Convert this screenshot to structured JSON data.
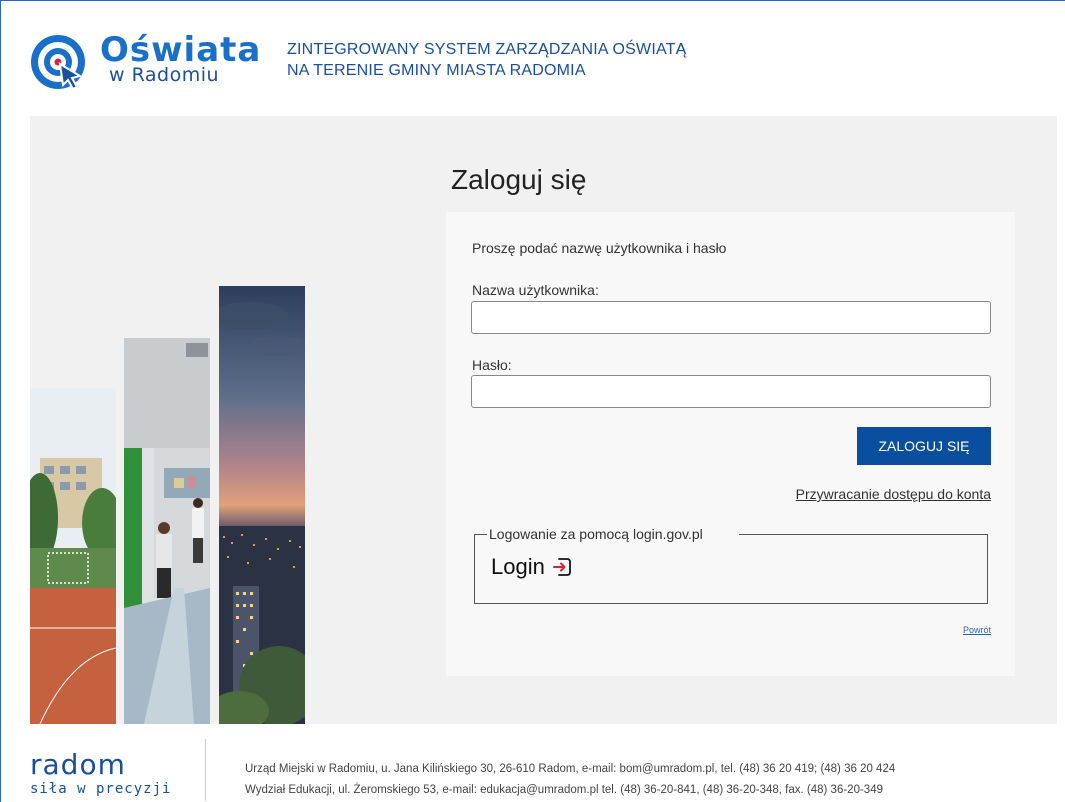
{
  "header": {
    "logo_title": "Oświata",
    "logo_subtitle": "w Radomiu",
    "system_title_line1": "ZINTEGROWANY SYSTEM ZARZĄDZANIA OŚWIATĄ",
    "system_title_line2": "NA TERENIE GMINY MIASTA RADOMIA"
  },
  "login": {
    "heading": "Zaloguj się",
    "instructions": "Proszę podać nazwę użytkownika i hasło",
    "username_label": "Nazwa użytkownika:",
    "username_value": "",
    "password_label": "Hasło:",
    "password_value": "",
    "submit_label": "ZALOGUJ SIĘ",
    "recover_link": "Przywracanie dostępu do konta",
    "gov_legend": "Logowanie za pomocą login.gov.pl",
    "gov_login_label": "Login",
    "back_link": "Powrót"
  },
  "footer": {
    "logo_title": "radom",
    "logo_tagline": "siła w precyzji",
    "line1": "Urząd Miejski w Radomiu, u. Jana Kilińskiego 30, 26-610 Radom, e-mail: bom@umradom.pl, tel. (48) 36 20 419; (48) 36 20 424",
    "line2": "Wydział Edukacji, ul. Żeromskiego 53, e-mail: edukacja@umradom.pl tel. (48) 36-20-841, (48) 36-20-348, fax. (48) 36-20-349"
  },
  "colors": {
    "brand_blue": "#1a6fc9",
    "button_blue": "#0a4ea0",
    "accent_red": "#d8213b"
  },
  "icons": {
    "logo": "target-cursor-icon",
    "gov_login": "login-arrow-icon"
  }
}
